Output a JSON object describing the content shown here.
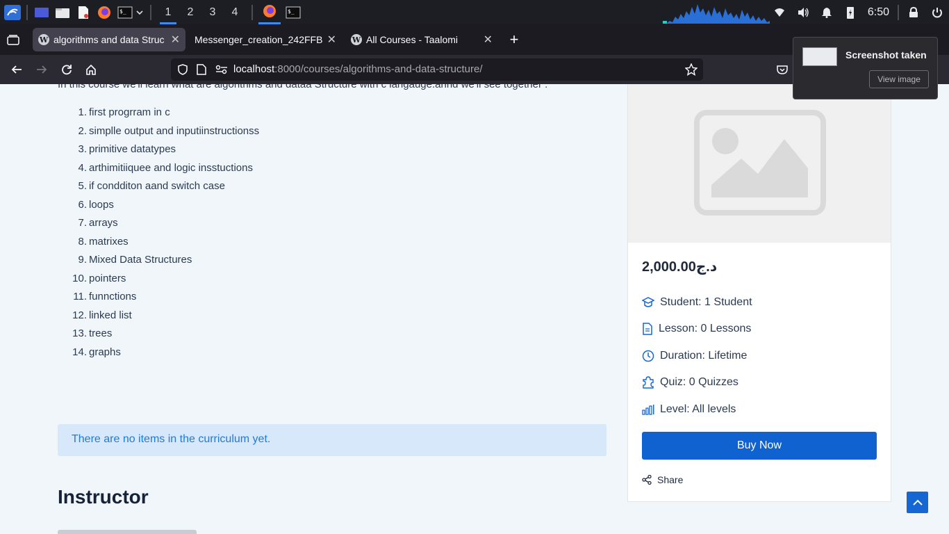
{
  "taskbar": {
    "workspaces": [
      "1",
      "2",
      "3",
      "4"
    ],
    "active_workspace": "1",
    "time": "6:50"
  },
  "browser": {
    "tabs": [
      {
        "title": "algorithms and data Struc",
        "active": true
      },
      {
        "title": "Messenger_creation_242FFB",
        "active": false
      },
      {
        "title": "All Courses - Taalomi",
        "active": false
      }
    ],
    "url_host": "localhost",
    "url_path": ":8000/courses/algorithms-and-data-structure/"
  },
  "content": {
    "intro": "In this course  we'll learn what are algorithms and dataa Structure with c langauge.annd we'll see  together :",
    "lessons": [
      {
        "num": "1.",
        "text": "first progrram in c"
      },
      {
        "num": "2.",
        "text": "simplle  output and inputiinstructionss"
      },
      {
        "num": "3.",
        "text": "primitive datatypes"
      },
      {
        "num": "4.",
        "text": "arthimitiiquee and logic insstuctions"
      },
      {
        "num": "5.",
        "text": "if condditon aand switch case"
      },
      {
        "num": "6.",
        "text": "loops"
      },
      {
        "num": "7.",
        "text": "arrays"
      },
      {
        "num": "8.",
        "text": "matrixes"
      },
      {
        "num": "9.",
        "text": "Mixed Data Structures"
      },
      {
        "num": "10.",
        "text": "pointers"
      },
      {
        "num": "11.",
        "text": "funnctions"
      },
      {
        "num": "12.",
        "text": "linked list"
      },
      {
        "num": "13.",
        "text": "trees"
      },
      {
        "num": "14.",
        "text": "graphs"
      }
    ],
    "curriculum_notice": "There are no items in the curriculum yet.",
    "instructor_heading": "Instructor"
  },
  "sidebar": {
    "price": "2,000.00د.ج",
    "student": "Student: 1 Student",
    "lesson": "Lesson: 0 Lessons",
    "duration": "Duration: Lifetime",
    "quiz": "Quiz: 0 Quizzes",
    "level": "Level: All levels",
    "buy_label": "Buy Now",
    "share_label": "Share"
  },
  "toast": {
    "title": "Screenshot taken",
    "button": "View image"
  },
  "colors": {
    "accent": "#0f62d0",
    "notice_bg": "#d7e8fa",
    "notice_text": "#1f7ad8",
    "icon_blue": "#1667d4"
  }
}
